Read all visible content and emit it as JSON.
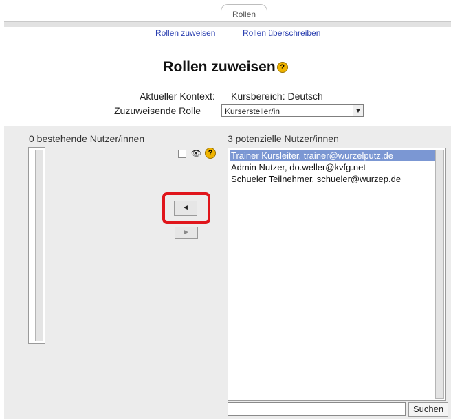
{
  "tabs": {
    "active_tab": "Rollen"
  },
  "subnav": {
    "assign": "Rollen zuweisen",
    "override": "Rollen überschreiben"
  },
  "page": {
    "title": "Rollen zuweisen"
  },
  "context": {
    "label": "Aktueller Kontext:",
    "value": "Kursbereich: Deutsch"
  },
  "role": {
    "label": "Zuzuweisende Rolle",
    "selected": "Kursersteller/in"
  },
  "existing_users": {
    "heading": "0 bestehende Nutzer/innen",
    "items": []
  },
  "potential_users": {
    "heading": "3 potenzielle Nutzer/innen",
    "items": [
      "Trainer Kursleiter, trainer@wurzelputz.de",
      "Admin Nutzer, do.weller@kvfg.net",
      "Schueler Teilnehmer, schueler@wurzep.de"
    ],
    "selected_index": 0
  },
  "buttons": {
    "add": "◄",
    "remove": "►"
  },
  "search": {
    "button_label": "Suchen",
    "value": ""
  },
  "colors": {
    "highlight": "#e0151b",
    "selected_row": "#7b97d3",
    "link": "#2a3fb0",
    "help_icon": "#f0b400"
  }
}
